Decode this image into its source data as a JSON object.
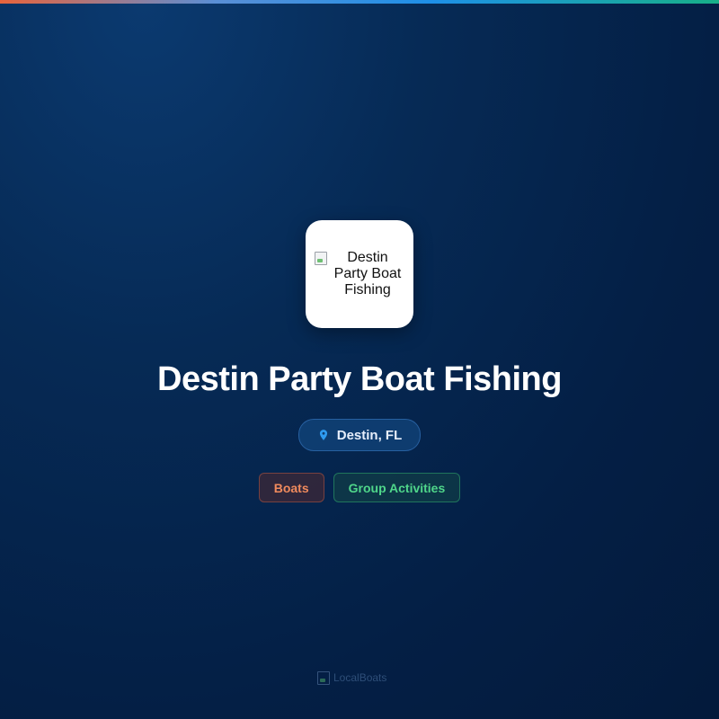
{
  "brand_colors": {
    "accent_orange": "#f08a5d",
    "accent_green": "#4fd68a",
    "accent_blue": "#1e90e8"
  },
  "listing": {
    "logo_alt": "Destin Party Boat Fishing",
    "title": "Destin Party Boat Fishing",
    "location": "Destin, FL",
    "location_icon": "map-pin-icon",
    "tags": [
      "Boats",
      "Group Activities"
    ]
  },
  "footer": {
    "logo_alt": "LocalBoats"
  }
}
